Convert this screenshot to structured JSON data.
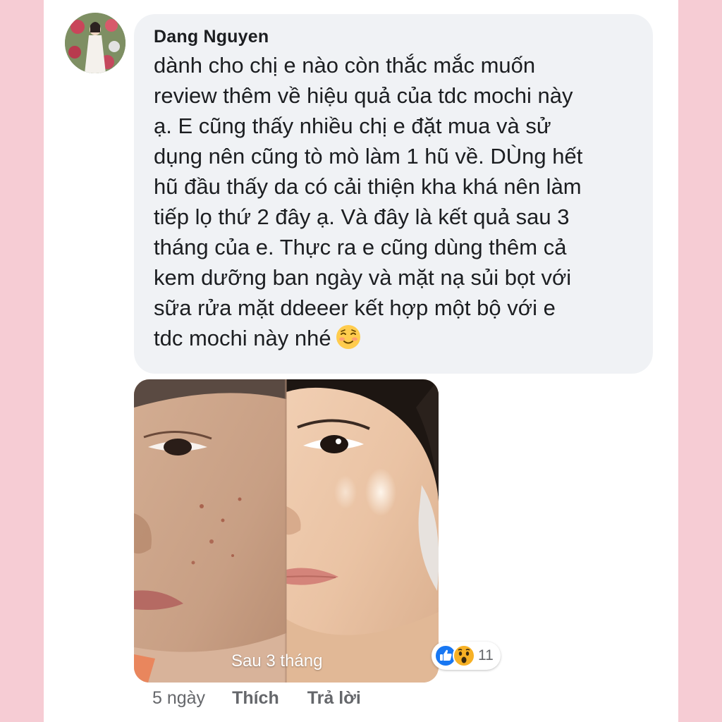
{
  "comment": {
    "author": "Dang Nguyen",
    "text": "dành cho chị e nào còn thắc mắc muốn\nreview thêm về hiệu quả của tdc mochi này\nạ. E cũng thấy nhiều chị e đặt mua và sử\ndụng nên cũng tò mò làm 1 hũ về. DÙng hết\nhũ đầu thấy da có cải thiện kha khá nên làm\ntiếp lọ thứ 2 đây ạ. Và đây là kết quả sau 3\ntháng của e. Thực ra e cũng dùng thêm cả\nkem dưỡng ban ngày và mặt nạ sủi bọt với\nsữa rửa mặt  ddeeer kết hợp một bộ với e\ntdc mochi này nhé",
    "emoji": "relieved-face-icon"
  },
  "photo": {
    "caption": "Sau 3 tháng"
  },
  "reactions": {
    "icons": [
      "like-icon",
      "wow-icon"
    ],
    "count": "11"
  },
  "actions": {
    "time": "5 ngày",
    "like_label": "Thích",
    "reply_label": "Trả lời"
  },
  "colors": {
    "background": "#f6ccd4",
    "bubble": "#f0f2f5",
    "text": "#1c1e21",
    "muted": "#65676b",
    "like_blue": "#1877f2",
    "wow_yellow": "#f7b125"
  }
}
